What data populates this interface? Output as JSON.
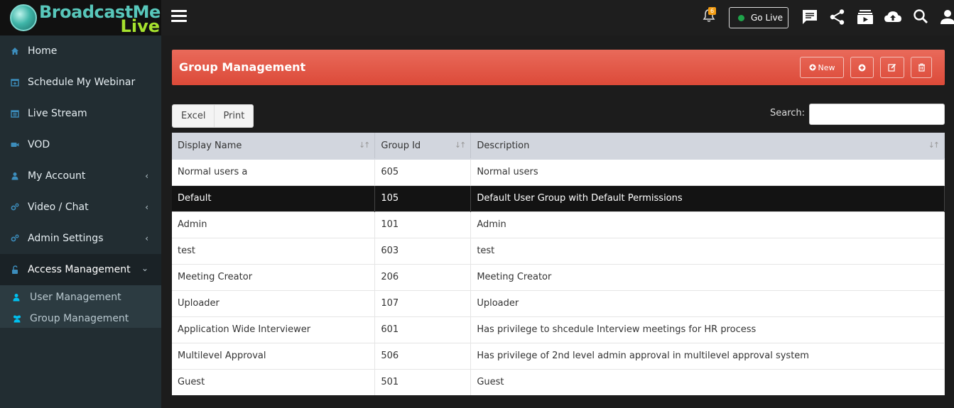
{
  "logo": {
    "line1": "BroadcastMe",
    "line2": "Live"
  },
  "sidebar": {
    "items": [
      {
        "label": "Home"
      },
      {
        "label": "Schedule My Webinar"
      },
      {
        "label": "Live Stream"
      },
      {
        "label": "VOD"
      },
      {
        "label": "My Account"
      },
      {
        "label": "Video / Chat"
      },
      {
        "label": "Admin Settings"
      },
      {
        "label": "Access Management"
      }
    ],
    "sub_items": [
      {
        "label": "User Management"
      },
      {
        "label": "Group Management"
      }
    ]
  },
  "topbar": {
    "notification_count": "6",
    "go_live_label": "Go Live"
  },
  "header": {
    "title": "Group Management",
    "new_label": "New"
  },
  "toolbar": {
    "excel_label": "Excel",
    "print_label": "Print"
  },
  "search": {
    "label": "Search:",
    "value": ""
  },
  "table": {
    "columns": [
      "Display Name",
      "Group Id",
      "Description"
    ],
    "rows": [
      {
        "name": "Normal users a",
        "id": "605",
        "description": "Normal users"
      },
      {
        "name": "Default",
        "id": "105",
        "description": "Default User Group with Default Permissions"
      },
      {
        "name": "Admin",
        "id": "101",
        "description": "Admin"
      },
      {
        "name": "test",
        "id": "603",
        "description": "test"
      },
      {
        "name": "Meeting Creator",
        "id": "206",
        "description": "Meeting Creator"
      },
      {
        "name": "Uploader",
        "id": "107",
        "description": "Uploader"
      },
      {
        "name": "Application Wide Interviewer",
        "id": "601",
        "description": "Has privilege to shcedule Interview meetings for HR process"
      },
      {
        "name": "Multilevel Approval",
        "id": "506",
        "description": "Has privilege of 2nd level admin approval in multilevel approval system"
      },
      {
        "name": "Guest",
        "id": "501",
        "description": "Guest"
      }
    ],
    "selected_row": 1
  },
  "colors": {
    "accent": "#3c8dbc",
    "header": "#dc4a39",
    "sidebar": "#222d32"
  }
}
